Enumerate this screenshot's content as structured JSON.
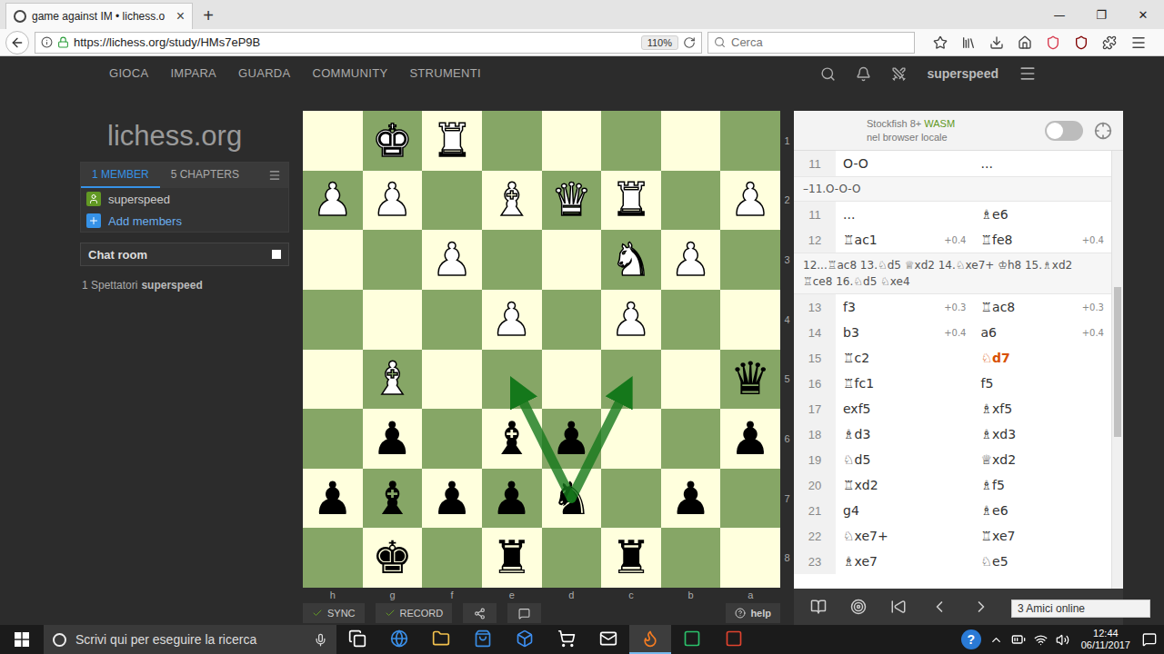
{
  "browser": {
    "tab": {
      "title": "game against IM • lichess.o",
      "close": "×",
      "selected": true
    },
    "new_tab": "+",
    "window_controls": [
      "—",
      "❐",
      "✕"
    ],
    "url": "https://lichess.org/study/HMs7eP9B",
    "zoom": "110%",
    "search_placeholder": "Cerca"
  },
  "site": {
    "nav": [
      "GIOCA",
      "IMPARA",
      "GUARDA",
      "COMMUNITY",
      "STRUMENTI"
    ],
    "user": "superspeed",
    "logo": "lichess.org"
  },
  "study": {
    "tabs": [
      {
        "label": "1 MEMBER",
        "selected": true
      },
      {
        "label": "5 CHAPTERS",
        "selected": false
      }
    ],
    "members": [
      {
        "label": "superspeed",
        "kind": "member"
      },
      {
        "label": "Add members",
        "kind": "add"
      }
    ],
    "chat_title": "Chat room",
    "spectators": "1 Spettatori",
    "spectator_names": [
      "superspeed"
    ]
  },
  "board": {
    "files": [
      "h",
      "g",
      "f",
      "e",
      "d",
      "c",
      "b",
      "a"
    ],
    "ranks": [
      "1",
      "2",
      "3",
      "4",
      "5",
      "6",
      "7",
      "8"
    ],
    "pieces": [
      {
        "square": "g1",
        "glyph": "♚",
        "side": "white"
      },
      {
        "square": "f1",
        "glyph": "♜",
        "side": "white"
      },
      {
        "square": "h2",
        "glyph": "♟",
        "side": "white"
      },
      {
        "square": "g2",
        "glyph": "♟",
        "side": "white"
      },
      {
        "square": "e2",
        "glyph": "♝",
        "side": "white"
      },
      {
        "square": "d2",
        "glyph": "♛",
        "side": "white"
      },
      {
        "square": "c2",
        "glyph": "♜",
        "side": "white"
      },
      {
        "square": "a2",
        "glyph": "♟",
        "side": "white"
      },
      {
        "square": "f3",
        "glyph": "♟",
        "side": "white"
      },
      {
        "square": "c3",
        "glyph": "♞",
        "side": "white"
      },
      {
        "square": "b3",
        "glyph": "♟",
        "side": "white"
      },
      {
        "square": "e4",
        "glyph": "♟",
        "side": "white"
      },
      {
        "square": "c4",
        "glyph": "♟",
        "side": "white"
      },
      {
        "square": "g5",
        "glyph": "♝",
        "side": "white"
      },
      {
        "square": "a5",
        "glyph": "♛",
        "side": "black"
      },
      {
        "square": "g6",
        "glyph": "♟",
        "side": "black"
      },
      {
        "square": "e6",
        "glyph": "♝",
        "side": "black"
      },
      {
        "square": "d6",
        "glyph": "♟",
        "side": "black"
      },
      {
        "square": "a6",
        "glyph": "♟",
        "side": "black"
      },
      {
        "square": "h7",
        "glyph": "♟",
        "side": "black"
      },
      {
        "square": "g7",
        "glyph": "♝",
        "side": "black"
      },
      {
        "square": "f7",
        "glyph": "♟",
        "side": "black"
      },
      {
        "square": "e7",
        "glyph": "♟",
        "side": "black"
      },
      {
        "square": "d7",
        "glyph": "♞",
        "side": "black"
      },
      {
        "square": "b7",
        "glyph": "♟",
        "side": "black"
      },
      {
        "square": "g8",
        "glyph": "♚",
        "side": "black"
      },
      {
        "square": "e8",
        "glyph": "♜",
        "side": "black"
      },
      {
        "square": "c8",
        "glyph": "♜",
        "side": "black"
      }
    ],
    "arrows": [
      {
        "from": "d7",
        "to": "e5"
      },
      {
        "from": "d7",
        "to": "c5"
      }
    ]
  },
  "board_tools": [
    {
      "label": "SYNC",
      "on": true
    },
    {
      "label": "RECORD",
      "on": true
    }
  ],
  "help": "help",
  "engine": {
    "name": "Stockfish 8+",
    "tag": "WASM",
    "subtitle": "nel browser locale",
    "on": false
  },
  "moves": [
    {
      "kind": "move",
      "number": "11",
      "white": {
        "san": "O-O",
        "eval": "",
        "selected": false
      },
      "black": {
        "san": "...",
        "eval": "",
        "selected": false
      }
    },
    {
      "kind": "variation",
      "text": "–11.O-O-O"
    },
    {
      "kind": "move",
      "number": "11",
      "white": {
        "san": "...",
        "eval": "",
        "selected": false
      },
      "black": {
        "san": "♗e6",
        "eval": "",
        "selected": false
      }
    },
    {
      "kind": "move",
      "number": "12",
      "white": {
        "san": "♖ac1",
        "eval": "+0.4",
        "selected": false
      },
      "black": {
        "san": "♖fe8",
        "eval": "+0.4",
        "selected": false
      }
    },
    {
      "kind": "variation",
      "text": "12...♖ac8 13.♘d5 ♕xd2 14.♘xe7+ ♔h8 15.♗xd2 ♖ce8 16.♘d5 ♘xe4"
    },
    {
      "kind": "move",
      "number": "13",
      "white": {
        "san": "f3",
        "eval": "+0.3",
        "selected": false
      },
      "black": {
        "san": "♖ac8",
        "eval": "+0.3",
        "selected": false
      }
    },
    {
      "kind": "move",
      "number": "14",
      "white": {
        "san": "b3",
        "eval": "+0.4",
        "selected": false
      },
      "black": {
        "san": "a6",
        "eval": "+0.4",
        "selected": false
      }
    },
    {
      "kind": "move",
      "number": "15",
      "white": {
        "san": "♖c2",
        "eval": "",
        "selected": false
      },
      "black": {
        "san": "♘d7",
        "eval": "",
        "selected": true
      }
    },
    {
      "kind": "move",
      "number": "16",
      "white": {
        "san": "♖fc1",
        "eval": "",
        "selected": false
      },
      "black": {
        "san": "f5",
        "eval": "",
        "selected": false
      }
    },
    {
      "kind": "move",
      "number": "17",
      "white": {
        "san": "exf5",
        "eval": "",
        "selected": false
      },
      "black": {
        "san": "♗xf5",
        "eval": "",
        "selected": false
      }
    },
    {
      "kind": "move",
      "number": "18",
      "white": {
        "san": "♗d3",
        "eval": "",
        "selected": false
      },
      "black": {
        "san": "♗xd3",
        "eval": "",
        "selected": false
      }
    },
    {
      "kind": "move",
      "number": "19",
      "white": {
        "san": "♘d5",
        "eval": "",
        "selected": false
      },
      "black": {
        "san": "♕xd2",
        "eval": "",
        "selected": false
      }
    },
    {
      "kind": "move",
      "number": "20",
      "white": {
        "san": "♖xd2",
        "eval": "",
        "selected": false
      },
      "black": {
        "san": "♗f5",
        "eval": "",
        "selected": false
      }
    },
    {
      "kind": "move",
      "number": "21",
      "white": {
        "san": "g4",
        "eval": "",
        "selected": false
      },
      "black": {
        "san": "♗e6",
        "eval": "",
        "selected": false
      }
    },
    {
      "kind": "move",
      "number": "22",
      "white": {
        "san": "♘xe7+",
        "eval": "",
        "selected": false
      },
      "black": {
        "san": "♖xe7",
        "eval": "",
        "selected": false
      }
    },
    {
      "kind": "move",
      "number": "23",
      "white": {
        "san": "♗xe7",
        "eval": "",
        "selected": false
      },
      "black": {
        "san": "♘e5",
        "eval": "",
        "selected": false
      }
    }
  ],
  "friends": "3 Amici online",
  "taskbar": {
    "search_placeholder": "Scrivi qui per eseguire la ricerca",
    "apps": [
      {
        "selected": false
      },
      {
        "selected": false
      },
      {
        "selected": false
      },
      {
        "selected": false
      },
      {
        "selected": false
      },
      {
        "selected": false
      },
      {
        "selected": false
      },
      {
        "selected": true
      },
      {
        "selected": false
      },
      {
        "selected": false
      }
    ],
    "help": "?",
    "time": "12:44",
    "date": "06/11/2017"
  }
}
